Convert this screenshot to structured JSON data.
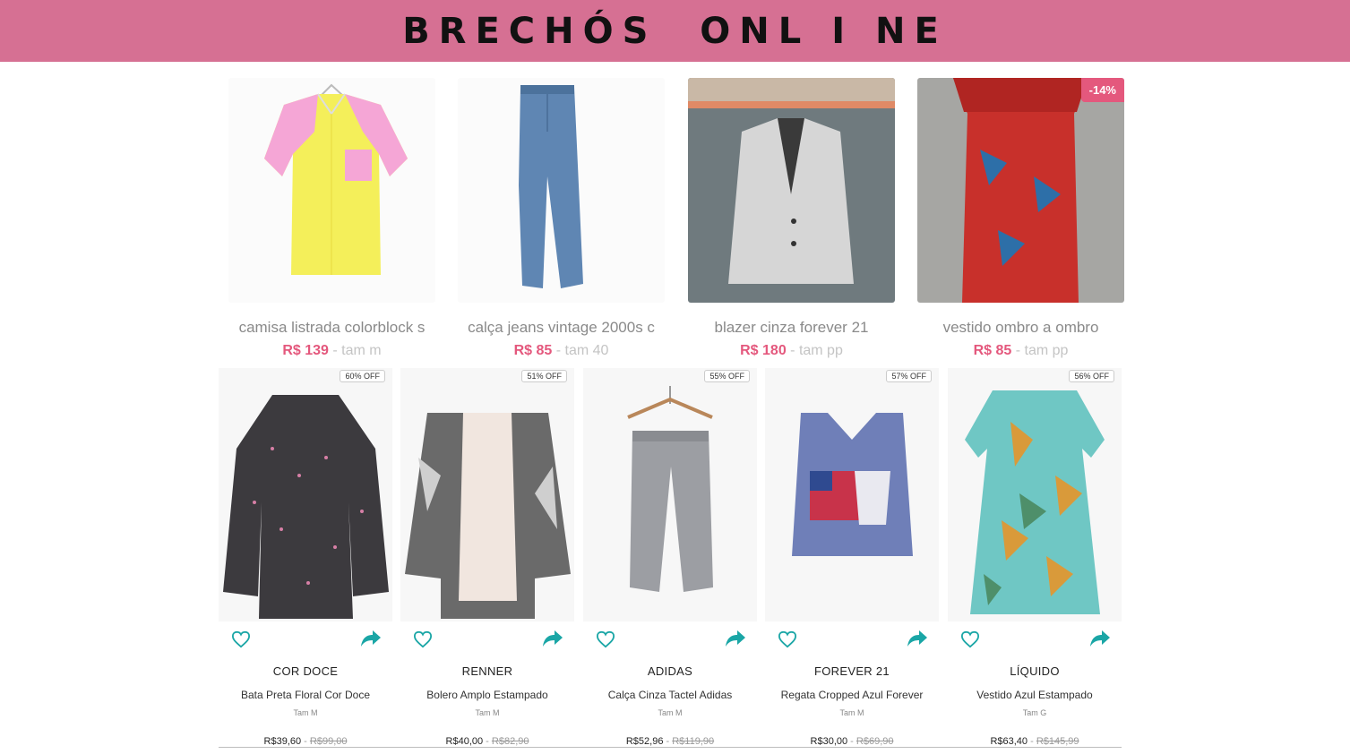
{
  "header": {
    "title": "BRECHÓS  ONL I NE"
  },
  "top_products": [
    {
      "name": "camisa listrada colorblock s",
      "price": "R$ 139",
      "size": " - tam m",
      "badge": ""
    },
    {
      "name": "calça jeans vintage 2000s c",
      "price": "R$ 85",
      "size": " - tam 40",
      "badge": ""
    },
    {
      "name": "blazer cinza forever 21",
      "price": "R$ 180",
      "size": " - tam pp",
      "badge": ""
    },
    {
      "name": "vestido ombro a ombro",
      "price": "R$ 85",
      "size": " - tam pp",
      "badge": "-14%"
    }
  ],
  "bottom_products": [
    {
      "badge": "60% OFF",
      "brand": "COR DOCE",
      "desc": "Bata Preta Floral Cor Doce",
      "size": "Tam M",
      "price": "R$39,60",
      "old_price": "R$99,00"
    },
    {
      "badge": "51% OFF",
      "brand": "RENNER",
      "desc": "Bolero Amplo Estampado",
      "size": "Tam M",
      "price": "R$40,00",
      "old_price": "R$82,90"
    },
    {
      "badge": "55% OFF",
      "brand": "ADIDAS",
      "desc": "Calça Cinza Tactel Adidas",
      "size": "Tam M",
      "price": "R$52,96",
      "old_price": "R$119,90"
    },
    {
      "badge": "57% OFF",
      "brand": "FOREVER 21",
      "desc": "Regata Cropped Azul Forever",
      "size": "Tam M",
      "price": "R$30,00",
      "old_price": "R$69,90"
    },
    {
      "badge": "56% OFF",
      "brand": "LÍQUIDO",
      "desc": "Vestido Azul Estampado",
      "size": "Tam G",
      "price": "R$63,40",
      "old_price": "R$145,99"
    }
  ],
  "separator": " - ",
  "icons": {
    "favorite": "heart-icon",
    "share": "share-icon"
  },
  "colors": {
    "banner": "#d67093",
    "accent": "#e4587d",
    "icon": "#1aa6a6"
  }
}
